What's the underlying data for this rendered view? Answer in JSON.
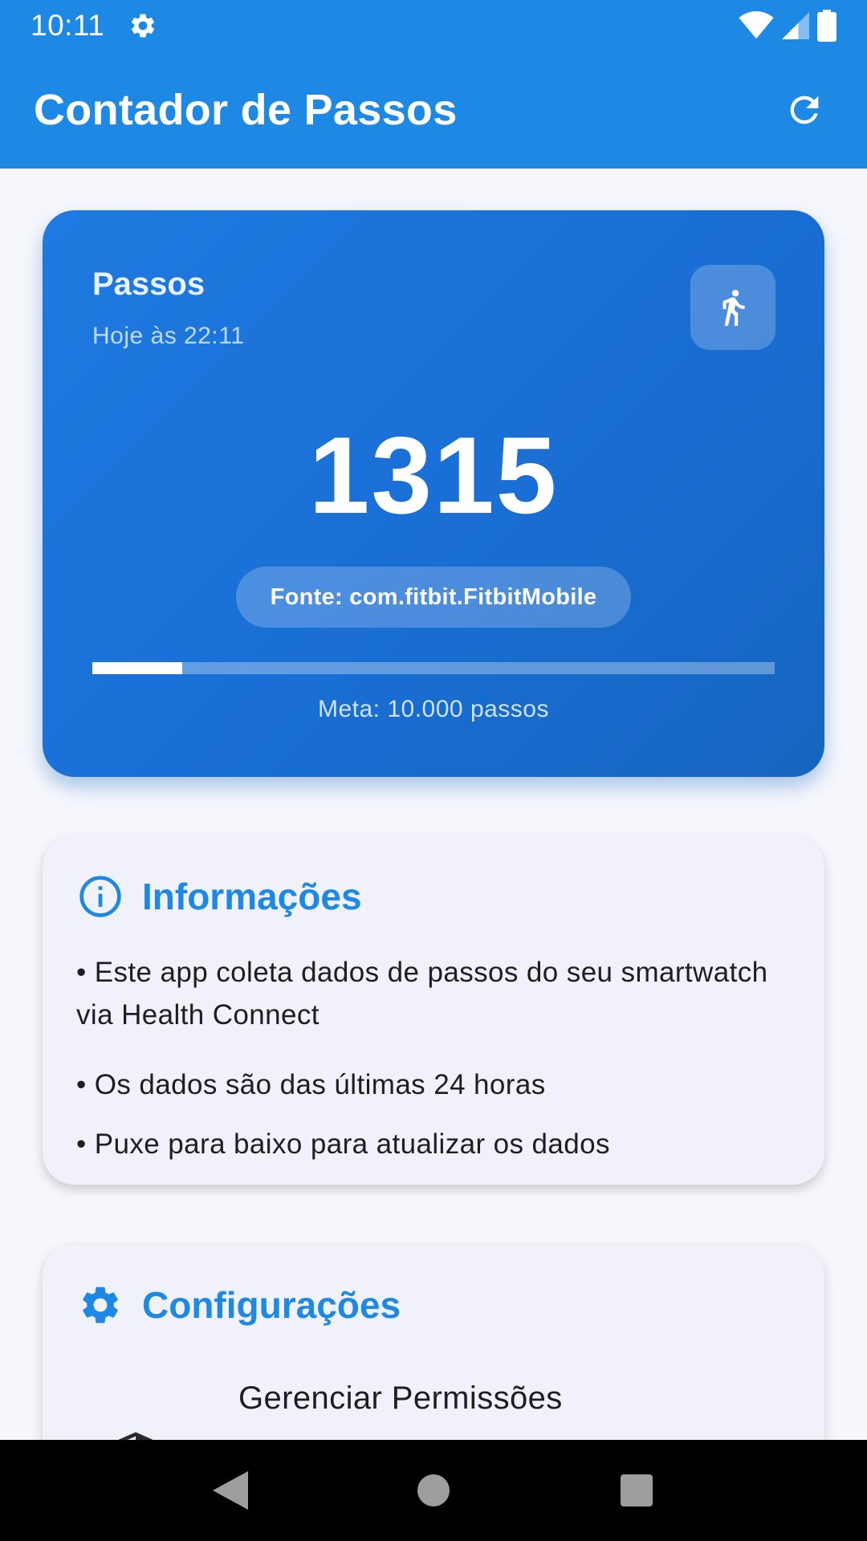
{
  "status_bar": {
    "time": "10:11"
  },
  "app_bar": {
    "title": "Contador de Passos"
  },
  "steps_card": {
    "title": "Passos",
    "timestamp": "Hoje às 22:11",
    "count": "1315",
    "source": "Fonte: com.fitbit.FitbitMobile",
    "progress_fraction": 0.1315,
    "goal": "Meta: 10.000 passos"
  },
  "info_card": {
    "title": "Informações",
    "bullets": [
      "• Este app coleta dados de passos do seu smartwatch via Health Connect",
      "• Os dados são das últimas 24 horas",
      "• Puxe para baixo para atualizar os dados"
    ]
  },
  "config_card": {
    "title": "Configurações",
    "items": [
      {
        "label": "Gerenciar Permissões",
        "icon": "shield-icon"
      }
    ]
  },
  "colors": {
    "primary": "#1e88e5",
    "card_gradient_start": "#1e7ae0",
    "card_gradient_end": "#1565c0",
    "card_bg": "#f1f2f9",
    "page_bg": "#f6f7fc"
  },
  "icons": {
    "status_settings": "gear-icon",
    "wifi": "wifi-icon",
    "signal": "signal-icon",
    "battery": "battery-icon",
    "refresh": "refresh-icon",
    "walk": "walk-icon",
    "info": "info-icon",
    "settings": "gear-icon",
    "nav_back": "back-triangle-icon",
    "nav_home": "home-circle-icon",
    "nav_recents": "recents-square-icon"
  }
}
